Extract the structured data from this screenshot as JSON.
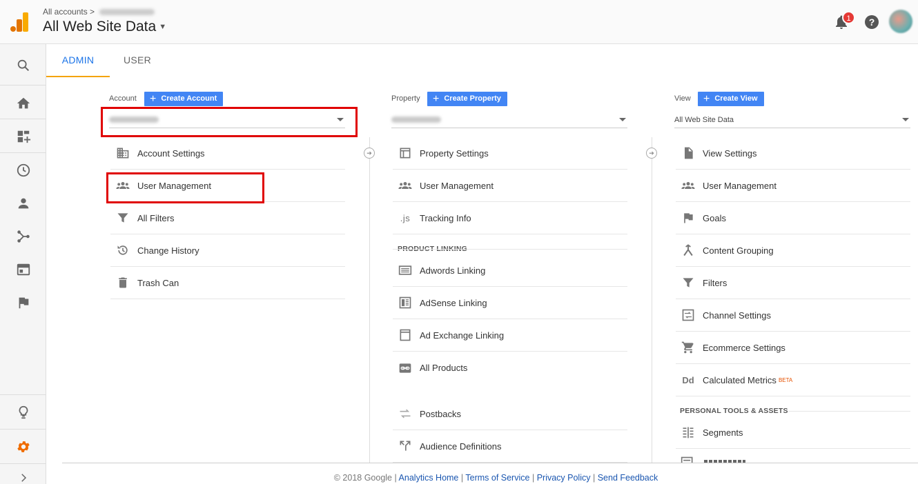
{
  "header": {
    "breadcrumb_root": "All accounts",
    "breadcrumb_sep": ">",
    "title": "All Web Site Data",
    "notification_count": "1"
  },
  "tabs": [
    {
      "label": "ADMIN",
      "active": true
    },
    {
      "label": "USER",
      "active": false
    }
  ],
  "account": {
    "label": "Account",
    "create_label": "Create Account",
    "items": [
      "Account Settings",
      "User Management",
      "All Filters",
      "Change History",
      "Trash Can"
    ]
  },
  "property": {
    "label": "Property",
    "create_label": "Create Property",
    "items": [
      "Property Settings",
      "User Management",
      "Tracking Info"
    ],
    "section_title": "PRODUCT LINKING",
    "linking_items": [
      "Adwords Linking",
      "AdSense Linking",
      "Ad Exchange Linking",
      "All Products",
      "Postbacks",
      "Audience Definitions"
    ]
  },
  "view": {
    "label": "View",
    "create_label": "Create View",
    "selected": "All Web Site Data",
    "items": [
      "View Settings",
      "User Management",
      "Goals",
      "Content Grouping",
      "Filters",
      "Channel Settings",
      "Ecommerce Settings",
      "Calculated Metrics"
    ],
    "beta_label": "BETA",
    "section_title": "PERSONAL TOOLS & ASSETS",
    "tools_items": [
      "Segments"
    ]
  },
  "icon_glyphs": {
    "js": ".js",
    "dd": "Dd"
  },
  "footer": {
    "copyright": "© 2018 Google",
    "sep": "|",
    "links": [
      "Analytics Home",
      "Terms of Service",
      "Privacy Policy",
      "Send Feedback"
    ]
  },
  "colors": {
    "accent_blue": "#4285f4",
    "tab_blue": "#1a73e8",
    "tab_underline": "#f4a300",
    "highlight_red": "#e00000",
    "settings_orange": "#ef6c00"
  }
}
